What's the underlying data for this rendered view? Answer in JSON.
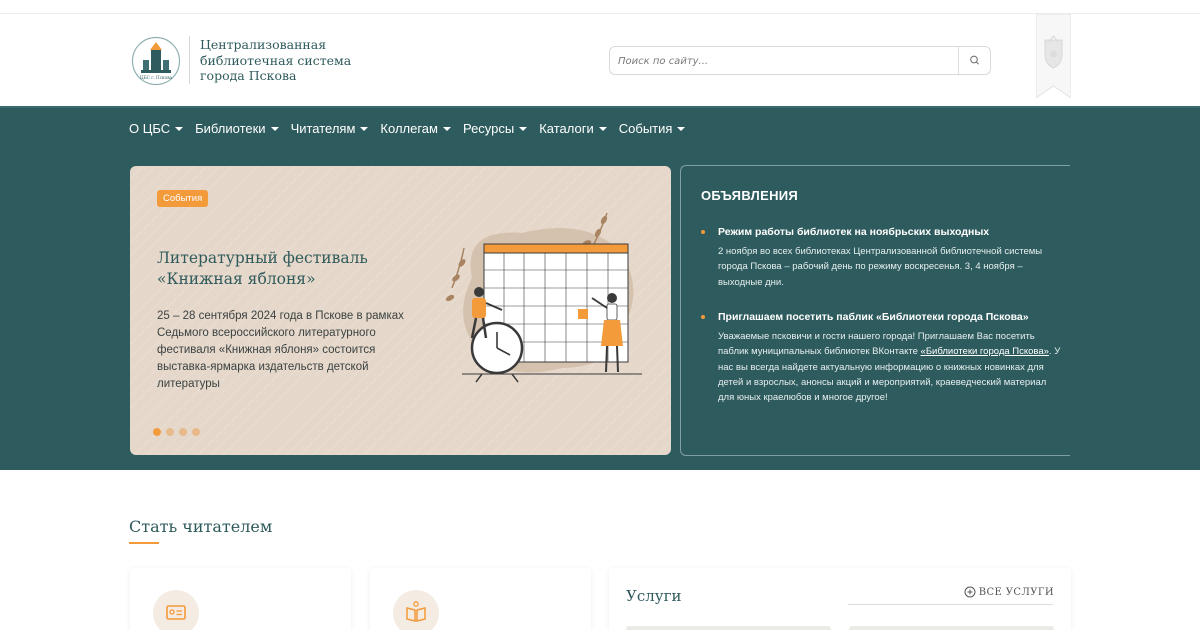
{
  "header": {
    "logo_caption": "ЦБС г. Пскова",
    "title_line1": "Централизованная",
    "title_line2": "библиотечная система",
    "title_line3": "города Пскова",
    "search_placeholder": "Поиск по сайту..."
  },
  "nav": {
    "items": [
      {
        "label": "О ЦБС"
      },
      {
        "label": "Библиотеки"
      },
      {
        "label": "Читателям"
      },
      {
        "label": "Коллегам"
      },
      {
        "label": "Ресурсы"
      },
      {
        "label": "Каталоги"
      },
      {
        "label": "События"
      }
    ]
  },
  "slide": {
    "badge": "События",
    "title": "Литературный фестиваль «Книжная яблоня»",
    "text": "25 – 28 сентября 2024 года в Пскове в рамках Седьмого всероссийского литературного фестиваля «Книжная яблоня» состоится выставка-ярмарка издательств детской литературы",
    "slides_total": 4,
    "slide_active": 1
  },
  "announcements": {
    "title": "ОБЪЯВЛЕНИЯ",
    "items": [
      {
        "heading": "Режим работы библиотек на ноябрьских выходных",
        "text": "2 ноября во всех библиотеках Централизованной библиотечной системы города Пскова – рабочий день по режиму воскресенья. 3, 4 ноября – выходные дни."
      },
      {
        "heading": "Приглашаем посетить паблик «Библиотеки города Пскова»",
        "text_before": "Уважаемые псковичи и гости нашего города! Приглашаем Вас посетить паблик муниципальных библиотек ВКонтакте ",
        "link": "«Библиотеки города Пскова»",
        "text_after": ". У нас вы всегда найдете актуальную информацию о книжных новинках для детей и взрослых, анонсы акций и мероприятий, краеведческий материал для юных краелюбов и многое другое!"
      }
    ]
  },
  "become_reader": {
    "title": "Стать читателем"
  },
  "services": {
    "title": "Услуги",
    "all_label": "ВСЕ УСЛУГИ"
  },
  "colors": {
    "teal": "#2e5b5e",
    "accent": "#f39a3b",
    "slide_bg": "#e5d7c9"
  }
}
